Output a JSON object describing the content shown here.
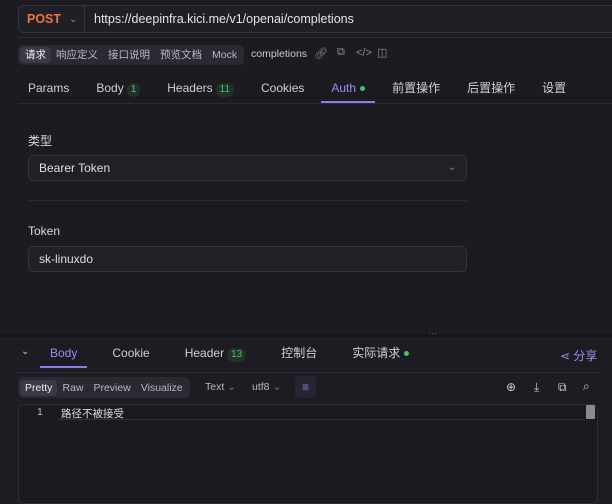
{
  "request": {
    "method": "POST",
    "url": "https://deepinfra.kici.me/v1/openai/completions"
  },
  "segments": [
    "请求",
    "响应定义",
    "接口说明",
    "预览文档",
    "Mock"
  ],
  "api_name": "completions",
  "tabs": [
    {
      "label": "Params"
    },
    {
      "label": "Body",
      "badge": "1"
    },
    {
      "label": "Headers",
      "badge": "11"
    },
    {
      "label": "Cookies"
    },
    {
      "label": "Auth",
      "active": true,
      "dot": true
    },
    {
      "label": "前置操作"
    },
    {
      "label": "后置操作"
    },
    {
      "label": "设置"
    }
  ],
  "auth": {
    "type_label": "类型",
    "type_value": "Bearer Token",
    "token_label": "Token",
    "token_value": "sk-linuxdo"
  },
  "response": {
    "tabs": [
      {
        "label": "Body"
      },
      {
        "label": "Cookie"
      },
      {
        "label": "Header",
        "badge": "13"
      },
      {
        "label": "控制台"
      },
      {
        "label": "实际请求"
      }
    ],
    "share": "分享",
    "views": [
      "Pretty",
      "Raw",
      "Preview",
      "Visualize"
    ],
    "format": "Text",
    "encoding": "utf8",
    "line_no": "1",
    "body": "路径不被接受"
  },
  "colors": {
    "accent": "#8e7be6",
    "method": "#f0763a",
    "green": "#45c46a"
  }
}
